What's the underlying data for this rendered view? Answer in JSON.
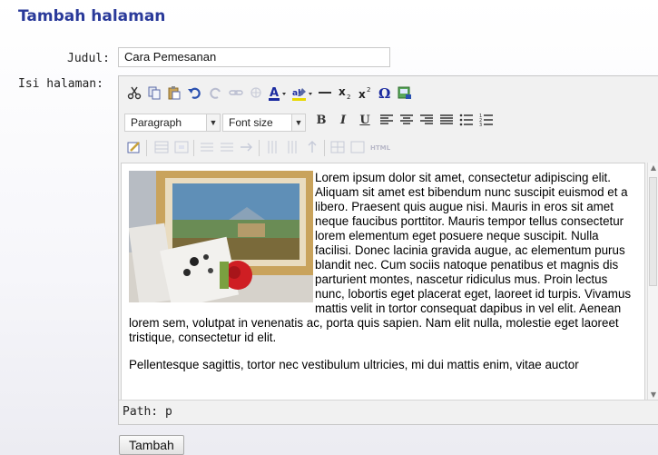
{
  "page": {
    "title": "Tambah halaman"
  },
  "form": {
    "title_label": "Judul:",
    "title_value": "Cara Pemesanan",
    "body_label": "Isi halaman:"
  },
  "editor": {
    "format_select": "Paragraph",
    "font_size_select": "Font size",
    "path_label": "Path:",
    "path_value": "p",
    "html_button": "HTML",
    "content": {
      "paragraph1": "Lorem ipsum dolor sit amet, consectetur adipiscing elit. Aliquam sit amet est bibendum nunc suscipit euismod et a libero. Praesent quis augue nisi. Mauris in eros sit amet neque faucibus porttitor. Mauris tempor tellus consectetur lorem elementum eget posuere neque suscipit. Nulla facilisi. Donec lacinia gravida augue, ac elementum purus blandit nec. Cum sociis natoque penatibus et magnis dis parturient montes, nascetur ridiculus mus. Proin lectus nunc, lobortis eget placerat eget, laoreet id turpis. Vivamus mattis velit in tortor consequat dapibus in vel elit. Aenean lorem sem, volutpat in venenatis ac, porta quis sapien. Nam elit nulla, molestie eget laoreet tristique, consectetur id elit.",
      "paragraph2": "Pellentesque sagittis, tortor nec vestibulum ultricies, mi dui mattis enim, vitae auctor"
    }
  },
  "buttons": {
    "submit": "Tambah"
  },
  "icons": {
    "row1": [
      "cut-icon",
      "copy-icon",
      "paste-icon",
      "undo-icon",
      "redo-icon",
      "link-icon",
      "unlink-icon",
      "text-color-icon",
      "highlight-color-icon",
      "horizontal-rule-icon",
      "subscript-icon",
      "superscript-icon",
      "special-char-icon",
      "insert-image-icon"
    ],
    "row2": [
      "bold-icon",
      "italic-icon",
      "underline-icon",
      "align-left-icon",
      "align-center-icon",
      "align-right-icon",
      "align-justify-icon",
      "bullet-list-icon",
      "numbered-list-icon"
    ],
    "row3": [
      "edit-table-icon",
      "table-icons",
      "html-icon"
    ]
  },
  "colors": {
    "title": "#2a3a9a",
    "text_color_a": "#1a2aa0",
    "highlight": "#e8d800"
  }
}
